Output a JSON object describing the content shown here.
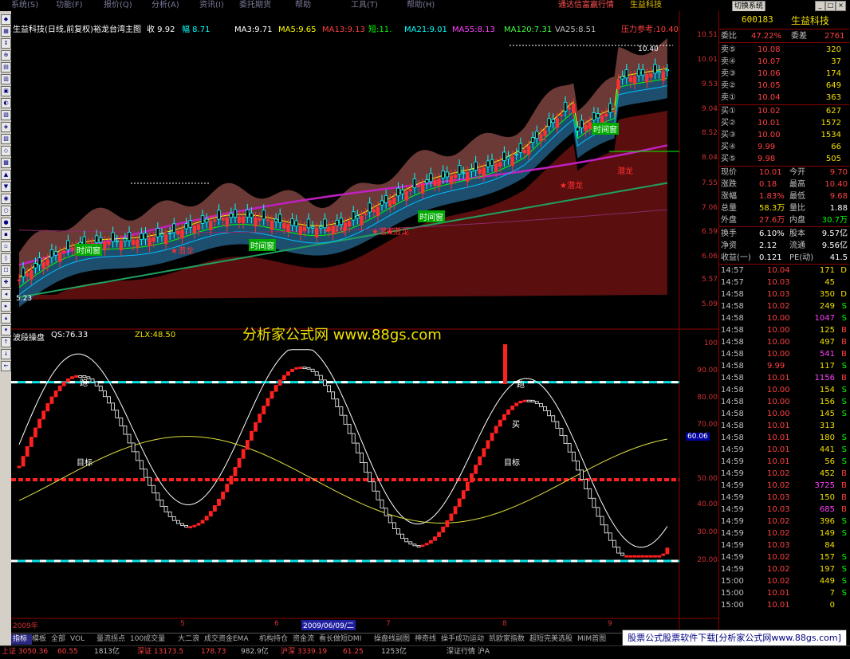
{
  "menu": {
    "items": [
      "系统(S)",
      "功能(F)",
      "报价(Q)",
      "分析(A)",
      "资讯(I)",
      "委托期货",
      "帮助",
      "工具(T)",
      "帮助(H)"
    ],
    "ticker_text": "通达信富赢行情",
    "stock_name": "生益科技",
    "switch_label": "切换系统"
  },
  "quote_line": {
    "title": "生益科技(日线,前复权)裕龙台湾主图",
    "items": [
      {
        "label": "收 9.92",
        "color": "#ffffff"
      },
      {
        "label": "幅 8.71",
        "color": "#00ffff"
      },
      {
        "label": "MA3:9.71",
        "color": "#ffffff"
      },
      {
        "label": "MA5:9.65",
        "color": "#ffff00"
      },
      {
        "label": "MA13:9.13",
        "color": "#ff4040"
      },
      {
        "label": "短:11.",
        "color": "#00ff00"
      },
      {
        "label": "MA21:9.01",
        "color": "#00ffff"
      },
      {
        "label": "MA55:8.13",
        "color": "#ff40ff"
      },
      {
        "label": "MA120:7.31",
        "color": "#40ff40"
      },
      {
        "label": "VA25:8.51",
        "color": "#c0c0c0"
      },
      {
        "label": "压力参考:10.40",
        "color": "#ff4040"
      }
    ]
  },
  "price_axis": [
    "10.51",
    "10.01",
    "9.53",
    "9.04",
    "8.52",
    "8.04",
    "7.55",
    "7.06",
    "6.59",
    "6.06",
    "5.57",
    "5.09"
  ],
  "high_label": "10.40",
  "low_label": "5.23",
  "watermark": "分析家公式网 www.88gs.com",
  "annotations": [
    {
      "text": "时间窗",
      "kind": "g"
    },
    {
      "text": "时间窗",
      "kind": "g"
    },
    {
      "text": "时间窗",
      "kind": "g"
    },
    {
      "text": "时间窗",
      "kind": "g"
    },
    {
      "text": "★潜龙",
      "kind": "r"
    },
    {
      "text": "★潜龙",
      "kind": "r"
    },
    {
      "text": "★潜龙",
      "kind": "r"
    },
    {
      "text": "★潜龙",
      "kind": "r"
    },
    {
      "text": "★潜龙",
      "kind": "r"
    },
    {
      "text": "潜龙",
      "kind": "r"
    }
  ],
  "indicator": {
    "name": "波段操盘",
    "qs": "QS:76.33",
    "zlx": "ZLX:48.50",
    "axis": [
      "100",
      "90.00",
      "80.00",
      "70.00",
      "60.06",
      "50.00",
      "40.00",
      "30.00",
      "20.00"
    ],
    "current": "60.06",
    "labels": [
      "跑",
      "目标",
      "目标",
      "跑",
      "买"
    ]
  },
  "time_axis": {
    "year": "2009年",
    "ticks": [
      "5",
      "6",
      "7",
      "8",
      "9"
    ],
    "cursor": "2009/06/09/二"
  },
  "tabs": [
    "指标",
    "模板",
    "全部",
    "VOL",
    "量流拐点",
    "100成交量",
    "大二浪",
    "成交资金EMA",
    "机构持仓",
    "资金流",
    "看长做短DMI",
    "操盘线副图",
    "神奇线",
    "操手成功运动",
    "凯欧家指数",
    "超短完美选股",
    "MIM首图"
  ],
  "active_tab": "指标",
  "promo": "股票公式股票软件下载[分析家公式网www.88gs.com]",
  "statusbar": [
    {
      "text": "上证 3050.36",
      "color": "#ff4040"
    },
    {
      "text": "60.55",
      "color": "#ff4040"
    },
    {
      "text": "1813亿",
      "color": "#c0c0c0"
    },
    {
      "text": "深证 13173.5",
      "color": "#ff4040"
    },
    {
      "text": "178.73",
      "color": "#ff4040"
    },
    {
      "text": "982.9亿",
      "color": "#c0c0c0"
    },
    {
      "text": "沪深 3339.19",
      "color": "#ff4040"
    },
    {
      "text": "61.25",
      "color": "#ff4040"
    },
    {
      "text": "1253亿",
      "color": "#c0c0c0"
    },
    {
      "text": "深证行情 沪A",
      "color": "#c0c0c0"
    }
  ],
  "side": {
    "code": "600183",
    "name": "生益科技",
    "weibi": {
      "label": "委比",
      "pct": "47.22%",
      "diff_label": "委差",
      "diff": "2761"
    },
    "asks": [
      {
        "label": "卖⑤",
        "price": "10.08",
        "vol": "320"
      },
      {
        "label": "卖④",
        "price": "10.07",
        "vol": "37"
      },
      {
        "label": "卖③",
        "price": "10.06",
        "vol": "174"
      },
      {
        "label": "卖②",
        "price": "10.05",
        "vol": "649"
      },
      {
        "label": "卖①",
        "price": "10.04",
        "vol": "363"
      }
    ],
    "bids": [
      {
        "label": "买①",
        "price": "10.02",
        "vol": "627"
      },
      {
        "label": "买②",
        "price": "10.01",
        "vol": "1572"
      },
      {
        "label": "买③",
        "price": "10.00",
        "vol": "1534"
      },
      {
        "label": "买④",
        "price": "9.99",
        "vol": "66"
      },
      {
        "label": "买⑤",
        "price": "9.98",
        "vol": "505"
      }
    ],
    "stats": [
      {
        "l1": "现价",
        "v1": "10.01",
        "c1": "#ff4040",
        "l2": "今开",
        "v2": "9.70",
        "c2": "#ff4040"
      },
      {
        "l1": "涨跌",
        "v1": "0.18",
        "c1": "#ff4040",
        "l2": "最高",
        "v2": "10.40",
        "c2": "#ff4040"
      },
      {
        "l1": "涨幅",
        "v1": "1.83%",
        "c1": "#ff4040",
        "l2": "最低",
        "v2": "9.68",
        "c2": "#ff4040"
      },
      {
        "l1": "总量",
        "v1": "58.3万",
        "c1": "#f0e000",
        "l2": "量比",
        "v2": "1.88",
        "c2": "#ffffff"
      },
      {
        "l1": "外盘",
        "v1": "27.6万",
        "c1": "#ff4040",
        "l2": "内盘",
        "v2": "30.7万",
        "c2": "#00ff00"
      },
      {
        "l1": "换手",
        "v1": "6.10%",
        "c1": "#ffffff",
        "l2": "股本",
        "v2": "9.57亿",
        "c2": "#ffffff"
      },
      {
        "l1": "净资",
        "v1": "2.12",
        "c1": "#ffffff",
        "l2": "流通",
        "v2": "9.56亿",
        "c2": "#ffffff"
      },
      {
        "l1": "收益(一)",
        "v1": "0.121",
        "c1": "#ffffff",
        "l2": "PE(动)",
        "v2": "41.5",
        "c2": "#ffffff"
      }
    ],
    "ticks": [
      {
        "t": "14:57",
        "p": "10.04",
        "v": "171",
        "s": "D"
      },
      {
        "t": "14:57",
        "p": "10.03",
        "v": "45",
        "s": ""
      },
      {
        "t": "14:58",
        "p": "10.03",
        "v": "350",
        "s": "D"
      },
      {
        "t": "14:58",
        "p": "10.02",
        "v": "249",
        "s": "S"
      },
      {
        "t": "14:58",
        "p": "10.00",
        "v": "1047",
        "s": "S"
      },
      {
        "t": "14:58",
        "p": "10.00",
        "v": "125",
        "s": "B"
      },
      {
        "t": "14:58",
        "p": "10.00",
        "v": "497",
        "s": "B"
      },
      {
        "t": "14:58",
        "p": "10.00",
        "v": "541",
        "s": "B"
      },
      {
        "t": "14:58",
        "p": "9.99",
        "v": "117",
        "s": "S"
      },
      {
        "t": "14:58",
        "p": "10.01",
        "v": "1156",
        "s": "B"
      },
      {
        "t": "14:58",
        "p": "10.00",
        "v": "154",
        "s": "S"
      },
      {
        "t": "14:58",
        "p": "10.00",
        "v": "156",
        "s": "S"
      },
      {
        "t": "14:58",
        "p": "10.00",
        "v": "145",
        "s": "S"
      },
      {
        "t": "14:58",
        "p": "10.01",
        "v": "313",
        "s": ""
      },
      {
        "t": "14:58",
        "p": "10.01",
        "v": "180",
        "s": "S"
      },
      {
        "t": "14:59",
        "p": "10.01",
        "v": "441",
        "s": "S"
      },
      {
        "t": "14:59",
        "p": "10.01",
        "v": "56",
        "s": "S"
      },
      {
        "t": "14:59",
        "p": "10.02",
        "v": "452",
        "s": "B"
      },
      {
        "t": "14:59",
        "p": "10.02",
        "v": "3725",
        "s": "B"
      },
      {
        "t": "14:59",
        "p": "10.03",
        "v": "150",
        "s": "B"
      },
      {
        "t": "14:59",
        "p": "10.03",
        "v": "685",
        "s": "B"
      },
      {
        "t": "14:59",
        "p": "10.02",
        "v": "396",
        "s": "S"
      },
      {
        "t": "14:59",
        "p": "10.02",
        "v": "149",
        "s": "S"
      },
      {
        "t": "14:59",
        "p": "10.03",
        "v": "84",
        "s": ""
      },
      {
        "t": "14:59",
        "p": "10.02",
        "v": "157",
        "s": "S"
      },
      {
        "t": "14:59",
        "p": "10.02",
        "v": "197",
        "s": "S"
      },
      {
        "t": "15:00",
        "p": "10.02",
        "v": "449",
        "s": "S"
      },
      {
        "t": "15:00",
        "p": "10.01",
        "v": "7",
        "s": "S"
      },
      {
        "t": "15:00",
        "p": "10.01",
        "v": "0",
        "s": ""
      }
    ]
  },
  "colors": {
    "up": "#ff3030",
    "down": "#00ffff",
    "axis": "#8b0000",
    "bg": "#000000"
  }
}
